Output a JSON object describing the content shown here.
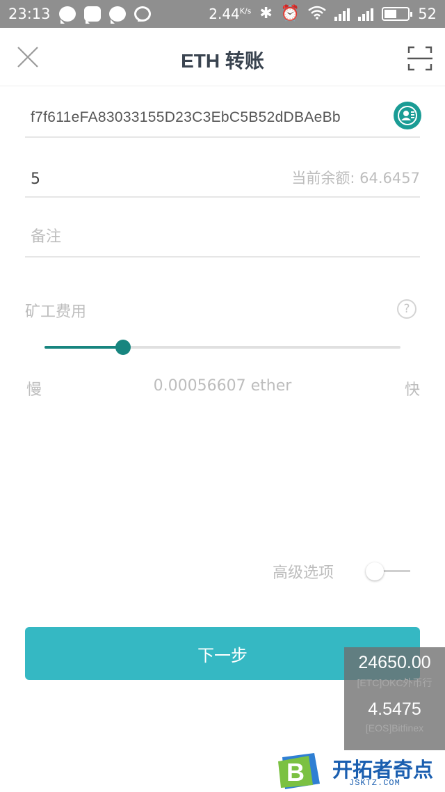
{
  "status_bar": {
    "time": "23:13",
    "speed": "2.44",
    "speed_unit": "K/s",
    "battery": "52"
  },
  "header": {
    "title": "ETH 转账",
    "close_icon": "close-icon",
    "scan_icon": "scan-icon"
  },
  "form": {
    "address": "f7f611eFA83033155D23C3EbC5B52dDBAeBb",
    "amount": "5",
    "balance": "当前余额: 64.6457",
    "memo_placeholder": "备注",
    "fee_label": "矿工费用",
    "help_label": "?",
    "slider_level": 0.22,
    "slow_label": "慢",
    "fee_value": "0.00056607 ether",
    "fast_label": "快",
    "advanced_label": "高级选项",
    "advanced_enabled": false,
    "next_label": "下一步"
  },
  "ticker": {
    "items": [
      {
        "price": "24650.00",
        "source": "[ETC]OKC外币行"
      },
      {
        "price": "4.5475",
        "source": "[EOS]Bitfinex"
      }
    ]
  },
  "watermark": {
    "logo_letter": "B",
    "name": "开拓者奇点",
    "url": "JSKTZ.COM"
  },
  "colors": {
    "accent": "#17857f",
    "button": "#35b8c3",
    "status_bar": "#8f8f8f"
  }
}
